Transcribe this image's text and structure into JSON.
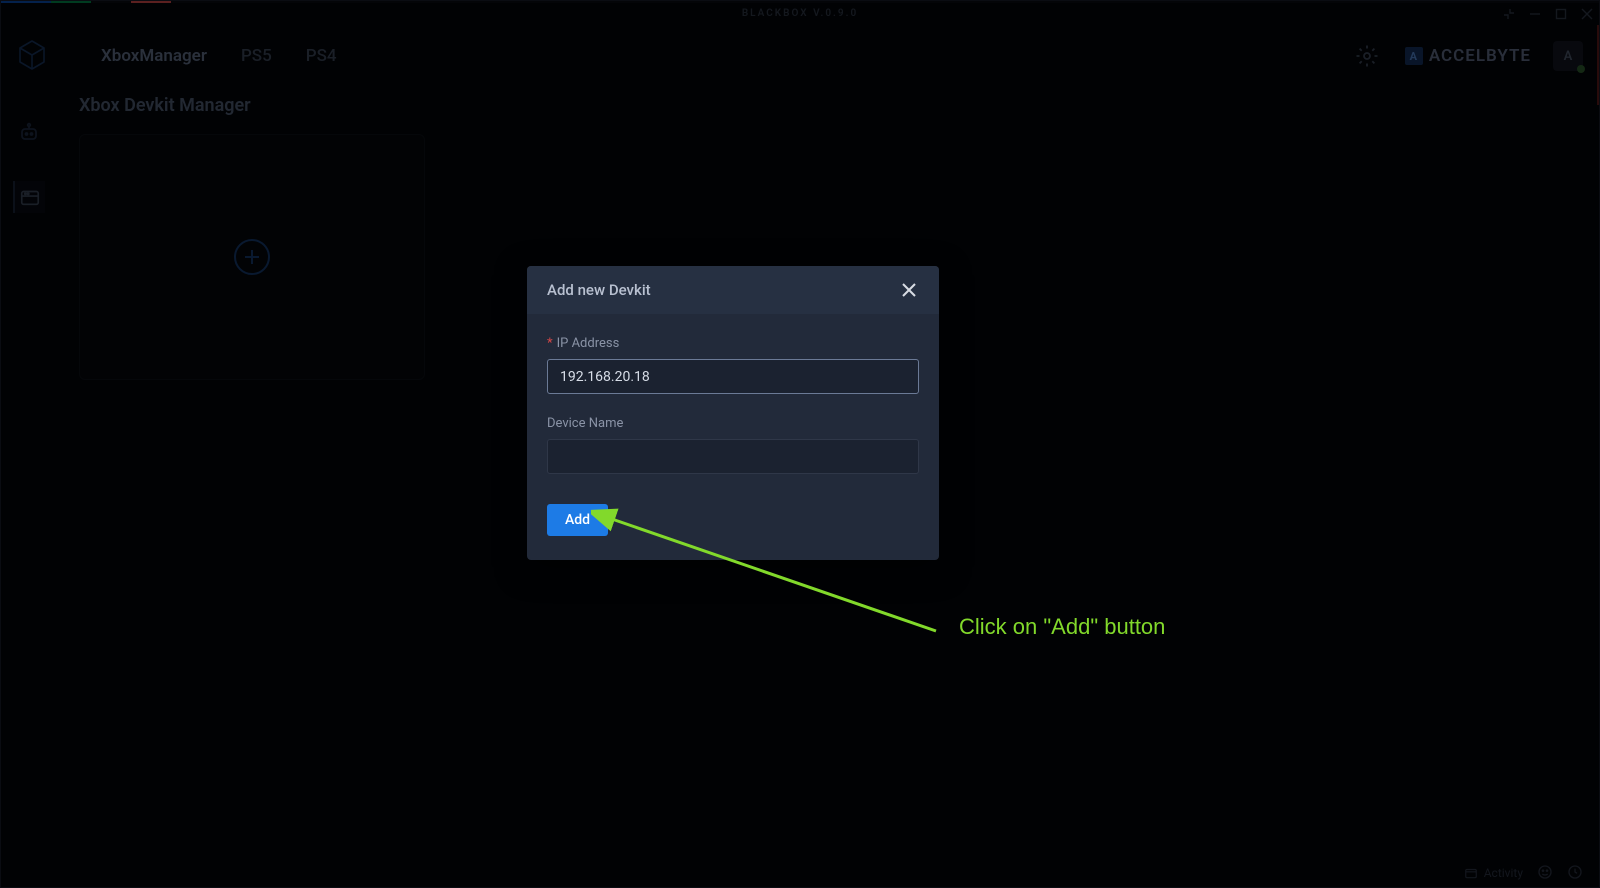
{
  "titlebar": {
    "app_title": "BLACKBOX V.0.9.0"
  },
  "header": {
    "tabs": [
      {
        "label": "XboxManager",
        "active": true
      },
      {
        "label": "PS5",
        "active": false
      },
      {
        "label": "PS4",
        "active": false
      }
    ],
    "brand_text": "ACCELBYTE",
    "user_initial": "A"
  },
  "page": {
    "title": "Xbox Devkit Manager"
  },
  "modal": {
    "title": "Add new Devkit",
    "ip_label": "IP Address",
    "ip_value": "192.168.20.18",
    "device_name_label": "Device Name",
    "device_name_value": "",
    "add_button": "Add"
  },
  "annotation": {
    "text": "Click on \"Add\" button"
  },
  "statusbar": {
    "activity_label": "Activity"
  },
  "strip_colors": [
    "#0a4aa8",
    "#008348",
    "#c94848",
    "#0a0c12",
    "#0a0c12"
  ]
}
